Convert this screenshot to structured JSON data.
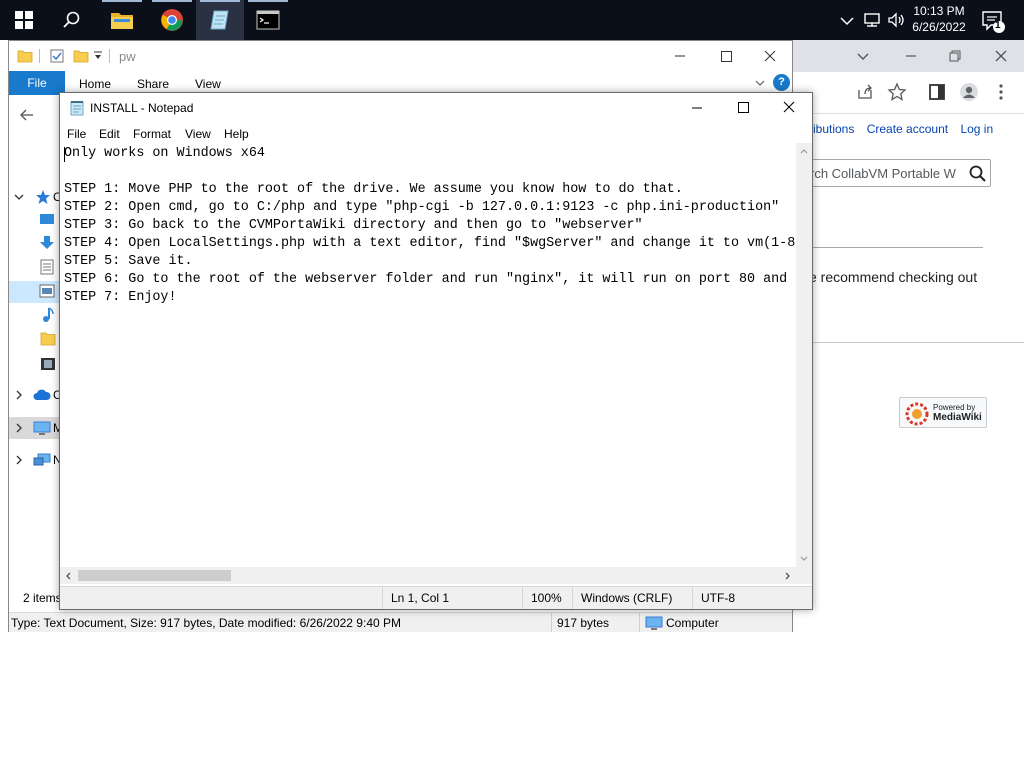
{
  "taskbar": {
    "clock_time": "10:13 PM",
    "clock_date": "6/26/2022",
    "notification_count": "1",
    "apps": [
      "start",
      "search",
      "file-explorer",
      "chrome",
      "notepad",
      "command-prompt"
    ]
  },
  "browser": {
    "links": [
      "ributions",
      "Create account",
      "Log in"
    ],
    "search_placeholder": "rch CollabVM Portable W",
    "content_text": "e recommend checking out",
    "powered_by": "Powered by",
    "mediawiki": "MediaWiki"
  },
  "explorer": {
    "path": "pw",
    "ribbon_tabs": [
      "File",
      "Home",
      "Share",
      "View"
    ],
    "item_count": "2 items",
    "status_type": "Type: Text Document, Size: 917 bytes, Date modified: 6/26/2022 9:40 PM",
    "status_size": "917 bytes",
    "status_location": "Computer",
    "nav_labels": [
      "C",
      "C",
      "M",
      "N"
    ]
  },
  "notepad": {
    "title": "INSTALL - Notepad",
    "menu": [
      "File",
      "Edit",
      "Format",
      "View",
      "Help"
    ],
    "text": "Only works on Windows x64\n\nSTEP 1: Move PHP to the root of the drive. We assume you know how to do that.\nSTEP 2: Open cmd, go to C:/php and type \"php-cgi -b 127.0.0.1:9123 -c php.ini-production\"\nSTEP 3: Go back to the CVMPortaWiki directory and then go to \"webserver\"\nSTEP 4: Open LocalSettings.php with a text editor, find \"$wgServer\" and change it to vm(1-8\nSTEP 5: Save it.\nSTEP 6: Go to the root of the webserver folder and run \"nginx\", it will run on port 80 and\nSTEP 7: Enjoy!",
    "status": {
      "position": "Ln 1, Col 1",
      "zoom": "100%",
      "line_ending": "Windows (CRLF)",
      "encoding": "UTF-8"
    }
  },
  "colors": {
    "taskbar": "#0b0f19",
    "ribbon_file": "#1979ca",
    "link": "#0645ad"
  }
}
